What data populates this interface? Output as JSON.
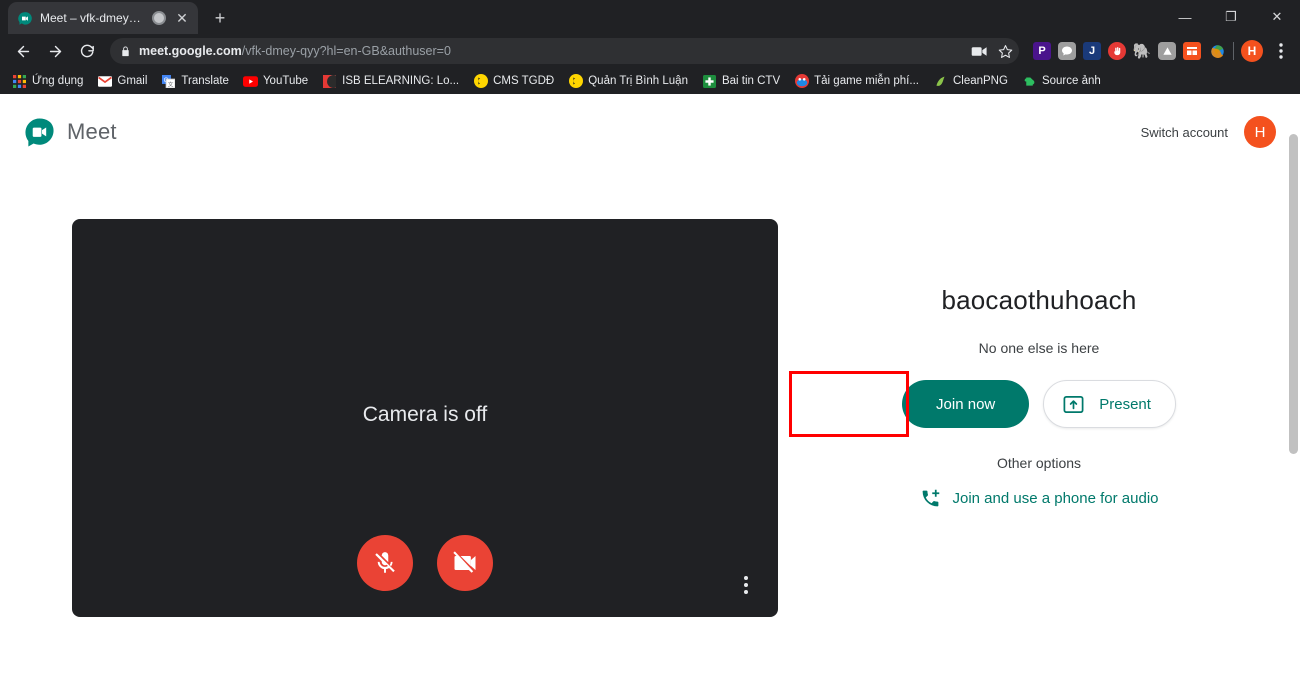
{
  "browser": {
    "tab": {
      "title": "Meet – vfk-dmey-qyy",
      "favicon_icon": "meet-favicon",
      "recording_icon": "tab-recording-indicator",
      "close_icon": "close-icon"
    },
    "new_tab_label": "+",
    "window_controls": {
      "minimize": "—",
      "maximize": "❐",
      "close": "✕"
    },
    "nav": {
      "back_icon": "back-arrow-icon",
      "forward_icon": "forward-arrow-icon",
      "reload_icon": "reload-icon"
    },
    "omnibox": {
      "lock_icon": "lock-icon",
      "url_domain": "meet.google.com",
      "url_path": "/vfk-dmey-qyy?hl=en-GB&authuser=0",
      "camera_badge_icon": "camera-permission-icon",
      "bookmark_star_icon": "star-icon"
    },
    "extensions": [
      {
        "name": "pocket-extension",
        "glyph": "P",
        "color": "#4a148c"
      },
      {
        "name": "chat-extension",
        "glyph": "●",
        "color": "#9e9e9e"
      },
      {
        "name": "j-extension",
        "glyph": "J",
        "color": "#1a3a7a"
      },
      {
        "name": "stop-hand-extension",
        "glyph": "✋",
        "color": "#e53935"
      },
      {
        "name": "evernote-extension",
        "glyph": "◆",
        "color": "#2dbe60"
      },
      {
        "name": "grey-extension",
        "glyph": "△",
        "color": "#9e9e9e"
      },
      {
        "name": "orange-extension",
        "glyph": "▤",
        "color": "#f4511e"
      },
      {
        "name": "globe-extension",
        "glyph": "◕",
        "color": "#43a047"
      }
    ],
    "profile_initial": "H",
    "menu_icon": "kebab-menu-icon",
    "bookmarks": [
      {
        "label": "Ứng dụng",
        "icon": "apps-grid-icon",
        "color": "#4285f4"
      },
      {
        "label": "Gmail",
        "icon": "gmail-icon",
        "color": "#ea4335"
      },
      {
        "label": "Translate",
        "icon": "translate-icon",
        "color": "#4285f4"
      },
      {
        "label": "YouTube",
        "icon": "youtube-icon",
        "color": "#ff0000"
      },
      {
        "label": "ISB ELEARNING: Lo...",
        "icon": "isb-elearning-icon",
        "color": "#e53935"
      },
      {
        "label": "CMS TGDĐ",
        "icon": "cms-tgdd-icon",
        "color": "#ffd600"
      },
      {
        "label": "Quản Trị Bình Luận",
        "icon": "comment-admin-icon",
        "color": "#ffd600"
      },
      {
        "label": "Bai tin CTV",
        "icon": "excel-sheet-icon",
        "color": "#1e8e3e"
      },
      {
        "label": "Tải game miễn phí...",
        "icon": "game-download-icon",
        "color": "#e53935"
      },
      {
        "label": "CleanPNG",
        "icon": "cleanpng-icon",
        "color": "#8bc34a"
      },
      {
        "label": "Source ảnh",
        "icon": "evernote-icon",
        "color": "#2dbe60"
      }
    ],
    "bookmarks_overflow_icon": "chevron-double-right-icon"
  },
  "meet": {
    "brand_name": "Meet",
    "logo_icon": "google-meet-logo",
    "switch_account_label": "Switch account",
    "account_initial": "H",
    "preview": {
      "camera_status_text": "Camera is off",
      "mic_button_icon": "microphone-off-icon",
      "camera_button_icon": "camera-off-icon",
      "more_options_icon": "more-vertical-icon"
    },
    "join": {
      "meeting_name": "baocaothuhoach",
      "participants_status": "No one else is here",
      "join_now_label": "Join now",
      "present_label": "Present",
      "present_icon": "present-screen-icon",
      "other_options_label": "Other options",
      "phone_audio_label": "Join and use a phone for audio",
      "phone_icon": "phone-add-icon"
    }
  },
  "colors": {
    "meet_teal": "#00796b",
    "highlight_red": "#ff0000",
    "control_red": "#ea4335",
    "avatar_orange": "#f4511e",
    "chrome_dark": "#202124"
  }
}
